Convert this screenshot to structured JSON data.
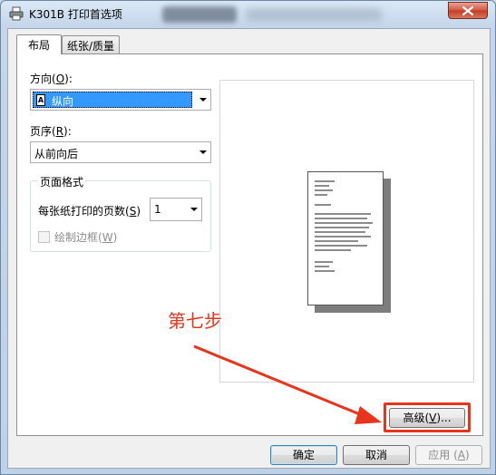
{
  "window": {
    "title": "K301B 打印首选项"
  },
  "tabs": [
    {
      "label": "布局",
      "active": true
    },
    {
      "label": "纸张/质量",
      "active": false
    }
  ],
  "layout": {
    "orientation_label": "方向(",
    "orientation_key": "O",
    "orientation_suffix": "):",
    "orientation_value": "纵向",
    "orientation_icon_letter": "A",
    "page_order_label": "页序(",
    "page_order_key": "R",
    "page_order_suffix": "):",
    "page_order_value": "从前向后",
    "page_format": {
      "title": "页面格式",
      "pages_per_sheet_label": "每张纸打印的页数(",
      "pages_per_sheet_key": "S",
      "pages_per_sheet_suffix": ")",
      "pages_per_sheet_value": "1",
      "draw_borders_label": "绘制边框(",
      "draw_borders_key": "W",
      "draw_borders_suffix": ")",
      "draw_borders_checked": false
    }
  },
  "annotation": {
    "text": "第七步",
    "color": "#e8341c"
  },
  "buttons": {
    "advanced_label": "高级(",
    "advanced_key": "V",
    "advanced_suffix": ")...",
    "ok": "确定",
    "cancel": "取消",
    "apply_label": "应用 (",
    "apply_key": "A",
    "apply_suffix": ")"
  },
  "icons": [
    "printer-icon",
    "close-icon",
    "portrait-orientation-icon",
    "dropdown-arrow-icon",
    "red-arrow-icon"
  ]
}
